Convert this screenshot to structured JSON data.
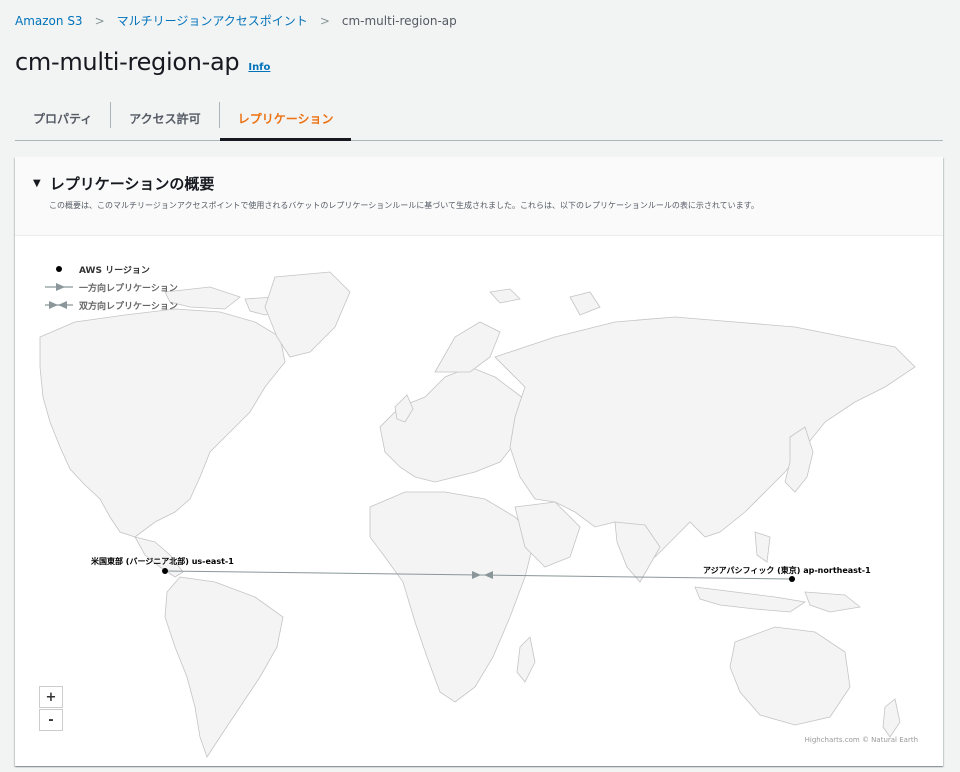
{
  "breadcrumb": {
    "root": "Amazon S3",
    "parent": "マルチリージョンアクセスポイント",
    "current": "cm-multi-region-ap"
  },
  "page": {
    "title": "cm-multi-region-ap",
    "info_label": "Info"
  },
  "tabs": [
    {
      "label": "プロパティ",
      "active": false
    },
    {
      "label": "アクセス許可",
      "active": false
    },
    {
      "label": "レプリケーション",
      "active": true
    }
  ],
  "overview": {
    "title": "レプリケーションの概要",
    "description": "この概要は、このマルチリージョンアクセスポイントで使用されるバケットのレプリケーションルールに基づいて生成されました。これらは、以下のレプリケーションルールの表に示されています。"
  },
  "legend": {
    "region": "AWS リージョン",
    "one_way": "一方向レプリケーション",
    "two_way": "双方向レプリケーション"
  },
  "map": {
    "regions": [
      {
        "label": "米国東部 (バージニア北部) us-east-1"
      },
      {
        "label": "アジアパシフィック (東京) ap-northeast-1"
      }
    ],
    "replication": {
      "type": "two_way"
    },
    "zoom_in": "+",
    "zoom_out": "-",
    "credits": "Highcharts.com © Natural Earth"
  },
  "colors": {
    "link": "#0073bb",
    "active_tab": "#ec7211",
    "land": "#f4f4f4",
    "land_stroke": "#c4c4c4",
    "route": "#8a9699"
  }
}
